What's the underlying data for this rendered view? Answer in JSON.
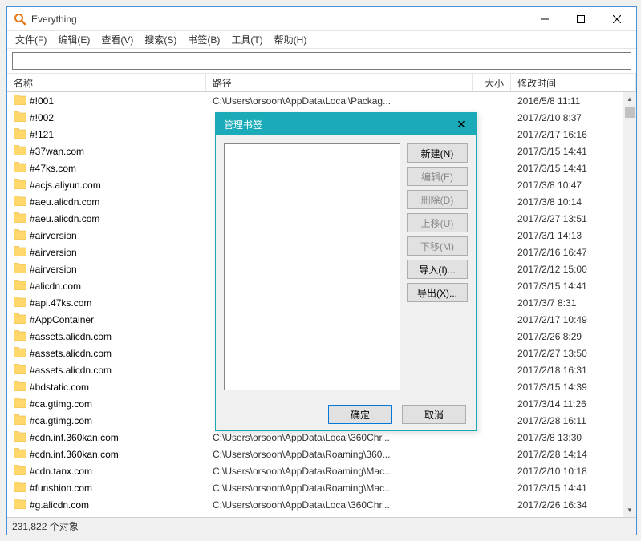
{
  "window": {
    "title": "Everything",
    "menu": [
      "文件(F)",
      "编辑(E)",
      "查看(V)",
      "搜索(S)",
      "书签(B)",
      "工具(T)",
      "帮助(H)"
    ],
    "search_value": ""
  },
  "columns": {
    "name": "名称",
    "path": "路径",
    "size": "大小",
    "mtime": "修改时间"
  },
  "rows": [
    {
      "name": "#!001",
      "path": "C:\\Users\\orsoon\\AppData\\Local\\Packag...",
      "mtime": "2016/5/8 11:11"
    },
    {
      "name": "#!002",
      "path": "",
      "mtime": "2017/2/10 8:37"
    },
    {
      "name": "#!121",
      "path": "",
      "mtime": "2017/2/17 16:16"
    },
    {
      "name": "#37wan.com",
      "path": "",
      "mtime": "2017/3/15 14:41"
    },
    {
      "name": "#47ks.com",
      "path": "",
      "mtime": "2017/3/15 14:41"
    },
    {
      "name": "#acjs.aliyun.com",
      "path": "",
      "mtime": "2017/3/8 10:47"
    },
    {
      "name": "#aeu.alicdn.com",
      "path": "",
      "mtime": "2017/3/8 10:14"
    },
    {
      "name": "#aeu.alicdn.com",
      "path": "",
      "mtime": "2017/2/27 13:51"
    },
    {
      "name": "#airversion",
      "path": "",
      "mtime": "2017/3/1 14:13"
    },
    {
      "name": "#airversion",
      "path": "",
      "mtime": "2017/2/16 16:47"
    },
    {
      "name": "#airversion",
      "path": "",
      "mtime": "2017/2/12 15:00"
    },
    {
      "name": "#alicdn.com",
      "path": "",
      "mtime": "2017/3/15 14:41"
    },
    {
      "name": "#api.47ks.com",
      "path": "",
      "mtime": "2017/3/7 8:31"
    },
    {
      "name": "#AppContainer",
      "path": "",
      "mtime": "2017/2/17 10:49"
    },
    {
      "name": "#assets.alicdn.com",
      "path": "",
      "mtime": "2017/2/26 8:29"
    },
    {
      "name": "#assets.alicdn.com",
      "path": "",
      "mtime": "2017/2/27 13:50"
    },
    {
      "name": "#assets.alicdn.com",
      "path": "",
      "mtime": "2017/2/18 16:31"
    },
    {
      "name": "#bdstatic.com",
      "path": "",
      "mtime": "2017/3/15 14:39"
    },
    {
      "name": "#ca.gtimg.com",
      "path": "",
      "mtime": "2017/3/14 11:26"
    },
    {
      "name": "#ca.gtimg.com",
      "path": "",
      "mtime": "2017/2/28 16:11"
    },
    {
      "name": "#cdn.inf.360kan.com",
      "path": "C:\\Users\\orsoon\\AppData\\Local\\360Chr...",
      "mtime": "2017/3/8 13:30"
    },
    {
      "name": "#cdn.inf.360kan.com",
      "path": "C:\\Users\\orsoon\\AppData\\Roaming\\360...",
      "mtime": "2017/2/28 14:14"
    },
    {
      "name": "#cdn.tanx.com",
      "path": "C:\\Users\\orsoon\\AppData\\Roaming\\Mac...",
      "mtime": "2017/2/10 10:18"
    },
    {
      "name": "#funshion.com",
      "path": "C:\\Users\\orsoon\\AppData\\Roaming\\Mac...",
      "mtime": "2017/3/15 14:41"
    },
    {
      "name": "#g.alicdn.com",
      "path": "C:\\Users\\orsoon\\AppData\\Local\\360Chr...",
      "mtime": "2017/2/26 16:34"
    }
  ],
  "status": "231,822 个对象",
  "dialog": {
    "title": "管理书签",
    "buttons": [
      {
        "label": "新建(N)",
        "enabled": true
      },
      {
        "label": "编辑(E)",
        "enabled": false
      },
      {
        "label": "删除(D)",
        "enabled": false
      },
      {
        "label": "上移(U)",
        "enabled": false
      },
      {
        "label": "下移(M)",
        "enabled": false
      },
      {
        "label": "导入(I)...",
        "enabled": true
      },
      {
        "label": "导出(X)...",
        "enabled": true
      }
    ],
    "ok": "确定",
    "cancel": "取消"
  }
}
